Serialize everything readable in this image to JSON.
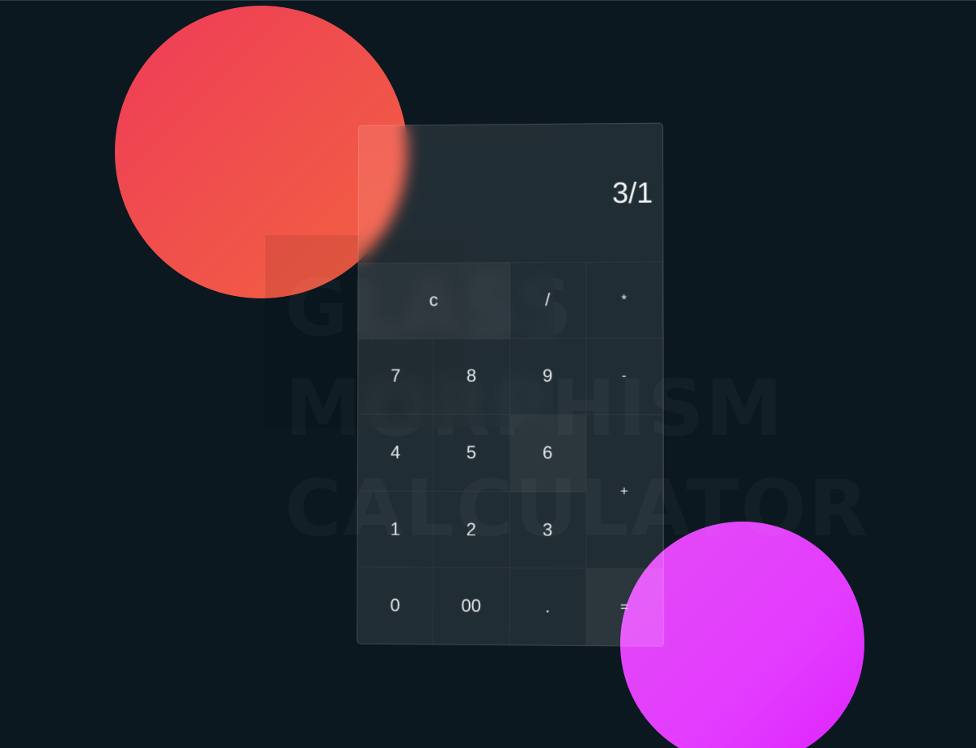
{
  "background_title": {
    "line1": "GLASS",
    "line2": "MORPHISM",
    "line3": "CALCULATOR"
  },
  "display": {
    "value": "3/1"
  },
  "keys": {
    "clear": "c",
    "divide": "/",
    "multiply": "*",
    "seven": "7",
    "eight": "8",
    "nine": "9",
    "minus": "-",
    "four": "4",
    "five": "5",
    "six": "6",
    "plus": "+",
    "one": "1",
    "two": "2",
    "three": "3",
    "zero": "0",
    "double_zero": "00",
    "dot": ".",
    "equals": "="
  },
  "colors": {
    "background": "#0b1820",
    "red_circle": "#f0504c",
    "pink_circle": "#e33cff"
  }
}
